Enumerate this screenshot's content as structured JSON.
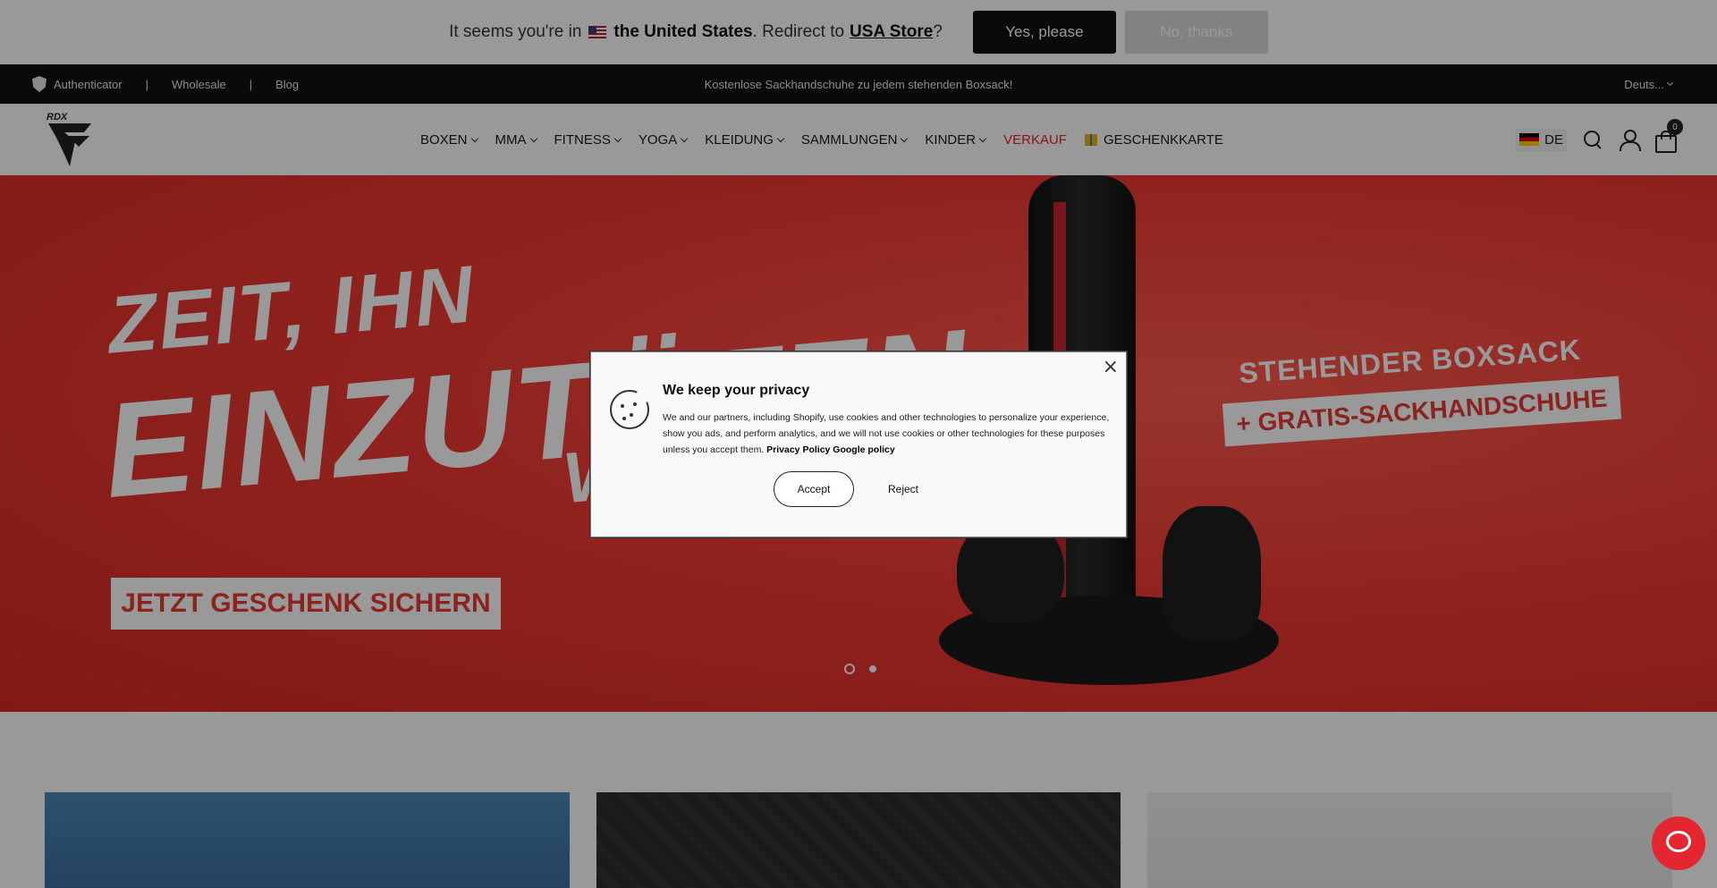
{
  "redirect": {
    "prefix": "It seems you're in",
    "country": "the United States",
    "middle": ". Redirect to",
    "store": "USA Store",
    "suffix": "?",
    "yes_label": "Yes, please",
    "no_label": "No, thanks"
  },
  "topbar": {
    "links": [
      "Authenticator",
      "Wholesale",
      "Blog"
    ],
    "announcement": "Kostenlose Sackhandschuhe zu jedem stehenden Boxsack!",
    "language": "Deuts..."
  },
  "header": {
    "logo_text": "RDX",
    "nav": [
      {
        "label": "BOXEN"
      },
      {
        "label": "MMA"
      },
      {
        "label": "FITNESS"
      },
      {
        "label": "YOGA"
      },
      {
        "label": "KLEIDUNG"
      },
      {
        "label": "SAMMLUNGEN"
      },
      {
        "label": "KINDER"
      },
      {
        "label": "VERKAUF"
      },
      {
        "label": "GESCHENKKARTE"
      }
    ],
    "lang_code": "DE",
    "cart_count": "0"
  },
  "hero": {
    "line1": "ZEIT, IHN",
    "line2": "EINZUTÜTEN",
    "line3": "W",
    "cta": "JETZT GESCHENK SICHERN",
    "right1": "STEHENDER BOXSACK",
    "right2": "+ GRATIS-SACKHANDSCHUHE"
  },
  "modal": {
    "title": "We keep your privacy",
    "body": "We and our partners, including Shopify, use cookies and other technologies to personalize your experience, show you ads, and perform analytics, and we will not use cookies or other technologies for these purposes unless you accept them.",
    "privacy_link": "Privacy Policy",
    "google_link": "Google policy",
    "accept_label": "Accept",
    "reject_label": "Reject",
    "close_label": "×"
  },
  "colors": {
    "accent": "#e3262f",
    "hero_bg": "#f03a33",
    "dark": "#121212"
  }
}
